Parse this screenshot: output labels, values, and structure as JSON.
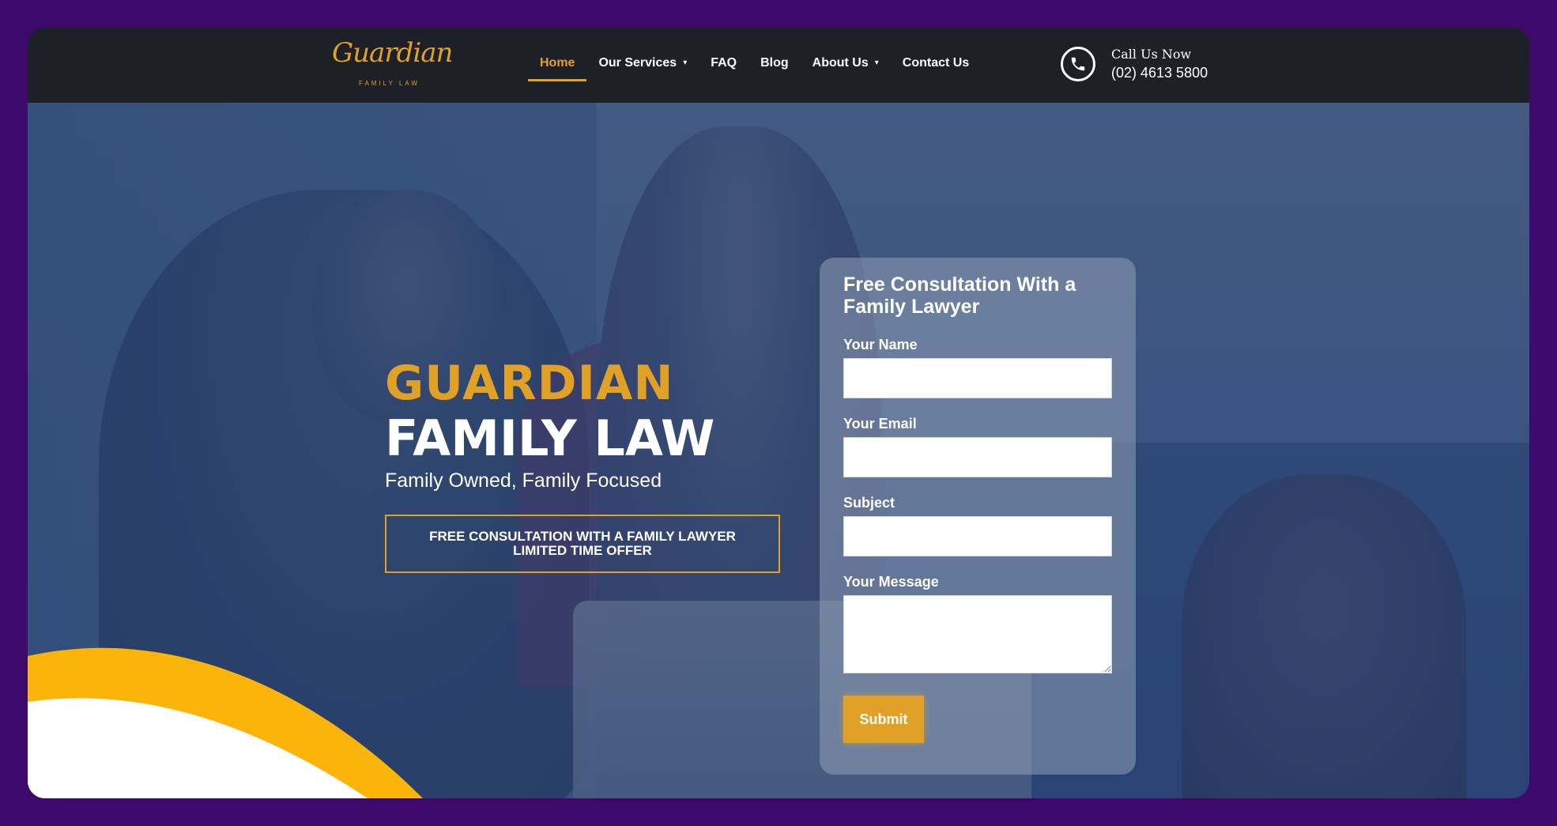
{
  "brand": {
    "logo_script": "Guardian",
    "logo_sub": "FAMILY LAW",
    "accent_color": "#e1a126",
    "background_color": "#3d0a6b",
    "header_color": "#1d2127"
  },
  "nav": {
    "items": [
      {
        "label": "Home",
        "active": true
      },
      {
        "label": "Our Services",
        "dropdown": true
      },
      {
        "label": "FAQ"
      },
      {
        "label": "Blog"
      },
      {
        "label": "About Us",
        "dropdown": true
      },
      {
        "label": "Contact Us"
      }
    ],
    "chevron": "▾"
  },
  "call": {
    "label": "Call Us Now",
    "number": "(02) 4613 5800",
    "icon": "phone-icon"
  },
  "hero": {
    "title_line1": "GUARDIAN",
    "title_line2": "FAMILY LAW",
    "tagline": "Family Owned, Family Focused",
    "offer_line1": "FREE CONSULTATION WITH A FAMILY LAWYER",
    "offer_line2": "LIMITED TIME OFFER"
  },
  "form": {
    "title": "Free Consultation With a Family Lawyer",
    "name_label": "Your Name",
    "name_value": "",
    "email_label": "Your Email",
    "email_value": "",
    "subject_label": "Subject",
    "subject_value": "",
    "message_label": "Your Message",
    "message_value": "",
    "submit_label": "Submit"
  }
}
